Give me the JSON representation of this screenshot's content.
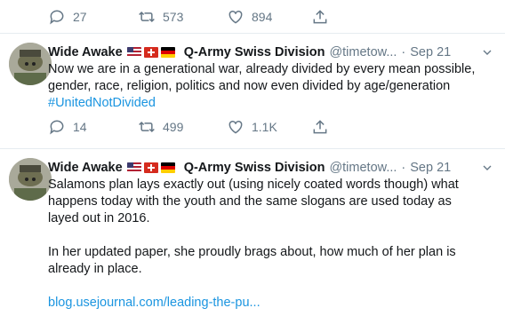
{
  "top_actions": {
    "replies": "27",
    "retweets": "573",
    "likes": "894"
  },
  "tweets": [
    {
      "author": "Wide Awake",
      "author_suffix": "Q-Army Swiss Division",
      "handle": "@timetow...",
      "date": "Sep 21",
      "dot": "·",
      "lines": [
        "Now we are in a generational war, already divided by every mean possible,",
        "gender, race, religion, politics and now even divided by age/generation"
      ],
      "hashtag": "#UnitedNotDivided",
      "replies": "14",
      "retweets": "499",
      "likes": "1.1K"
    },
    {
      "author": "Wide Awake",
      "author_suffix": "Q-Army Swiss Division",
      "handle": "@timetow...",
      "date": "Sep 21",
      "dot": "·",
      "para1": [
        "Salamons plan lays exactly out (using nicely coated words though) what",
        "happens today with the youth and the same slogans are used today as",
        "layed out in 2016."
      ],
      "para2": [
        "In her updated paper, she proudly brags about, how much of her plan is",
        "already in place."
      ],
      "link": "blog.usejournal.com/leading-the-pu..."
    }
  ],
  "colors": {
    "accent": "#1b95e0",
    "muted": "#657786",
    "text": "#14171a",
    "divider": "#e6ecf0"
  },
  "icons": [
    "reply-icon",
    "retweet-icon",
    "like-icon",
    "share-icon",
    "caret-down-icon",
    "flag-usa-icon",
    "flag-switzerland-icon",
    "flag-germany-icon"
  ]
}
